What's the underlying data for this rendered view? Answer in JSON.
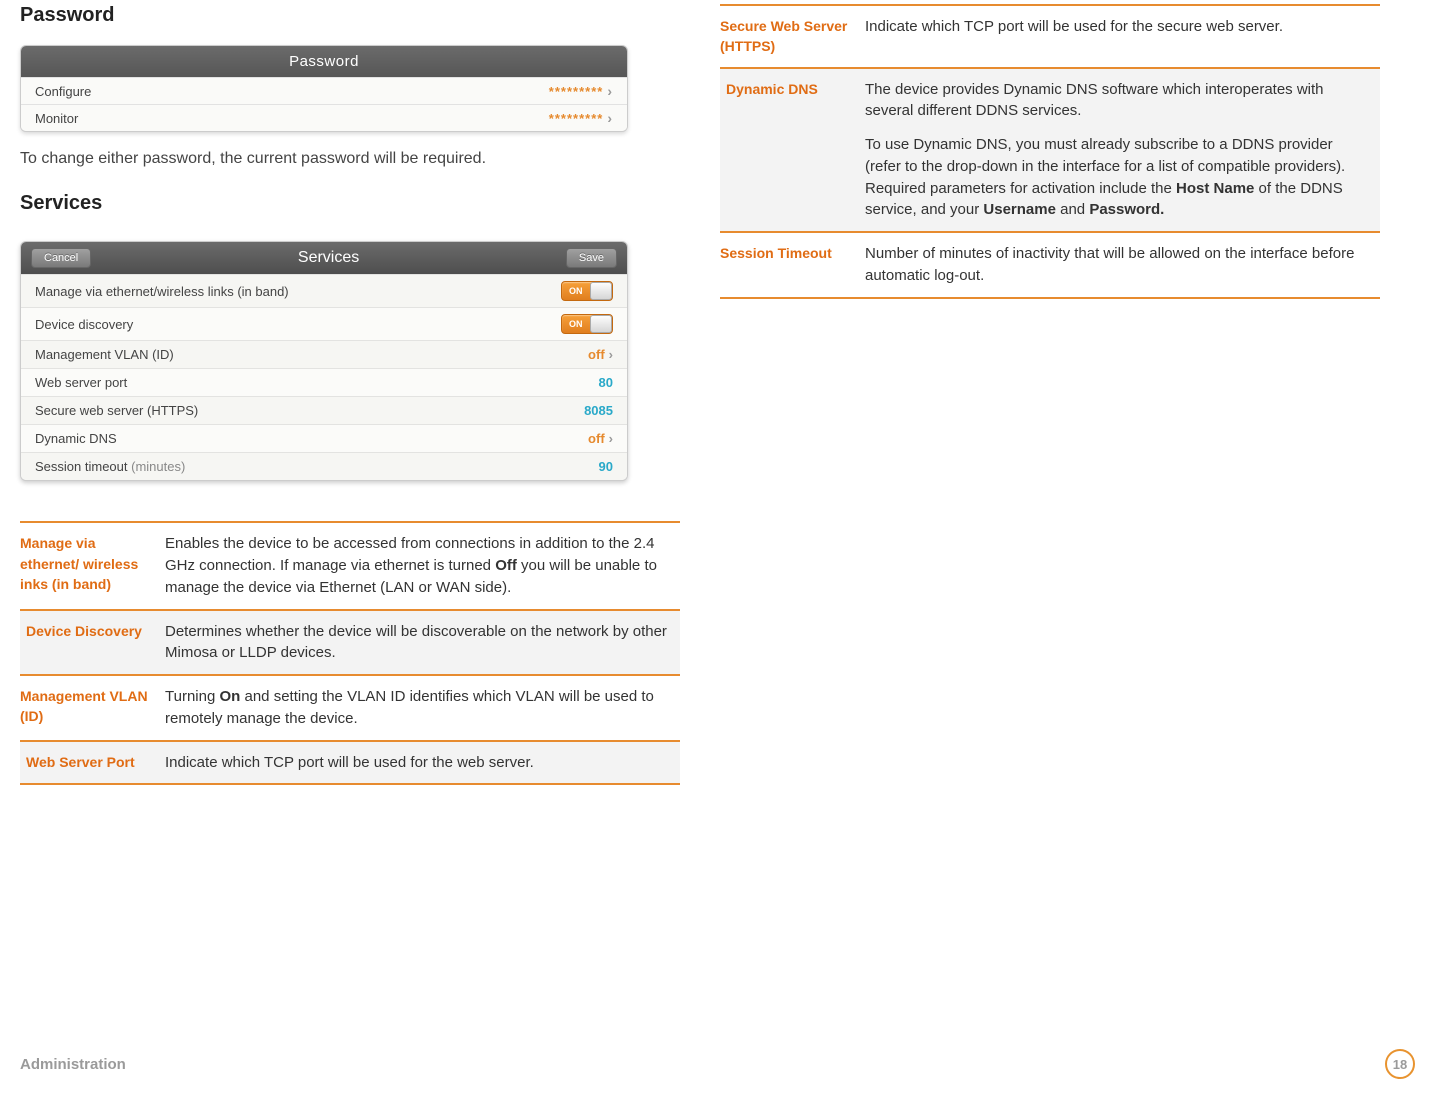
{
  "left": {
    "password": {
      "heading": "Password",
      "panel_title": "Password",
      "rows": [
        {
          "label": "Configure",
          "value": "*********"
        },
        {
          "label": "Monitor",
          "value": "*********"
        }
      ],
      "note": "To change either password, the current password will be required."
    },
    "services": {
      "heading": "Services",
      "panel_title": "Services",
      "cancel": "Cancel",
      "save": "Save",
      "rows": {
        "manage": {
          "label": "Manage via ethernet/wireless links (in band)",
          "toggle_text": "ON"
        },
        "discover": {
          "label": "Device discovery",
          "toggle_text": "ON"
        },
        "vlan": {
          "label": "Management VLAN (ID)",
          "value": "off"
        },
        "webport": {
          "label": "Web server port",
          "value": "80"
        },
        "https": {
          "label": "Secure web server (HTTPS)",
          "value": "8085"
        },
        "ddns": {
          "label": "Dynamic DNS",
          "value": "off"
        },
        "timeout": {
          "label_main": "Session timeout ",
          "label_muted": "(minutes)",
          "value": "90"
        }
      }
    },
    "defs": {
      "manage": {
        "term": "Manage via ethernet/ wireless inks (in band)",
        "desc_pre": "Enables the device to be accessed from connections in addition to the 2.4 GHz connection. If manage via ethernet is turned ",
        "desc_bold": "Off",
        "desc_post": " you will be unable to manage the device via Ethernet (LAN or WAN side)."
      },
      "discovery": {
        "term": "Device Discovery",
        "desc": "Determines whether the device will be discoverable on the network by other Mimosa or LLDP devices."
      },
      "vlan": {
        "term": "Management VLAN (ID)",
        "desc_pre": "Turning ",
        "desc_bold": "On",
        "desc_post": " and setting the VLAN ID identifies which VLAN will be used to remotely manage the device."
      },
      "webport": {
        "term": "Web Server Port",
        "desc": "Indicate which TCP port will be used for the web server."
      }
    }
  },
  "right": {
    "https": {
      "term": "Secure Web Server (HTTPS)",
      "desc": "Indicate which TCP port will be used for the secure web server."
    },
    "ddns": {
      "term": "Dynamic DNS",
      "p1": "The device provides Dynamic DNS software which interoperates with several different DDNS services.",
      "p2_pre": "To use Dynamic DNS, you must already subscribe to a DDNS provider (refer to the drop-down in the interface for a list of compatible providers). Required parameters for activation include the ",
      "p2_b1": "Host Name",
      "p2_mid": " of the DDNS service, and your ",
      "p2_b2": "Username",
      "p2_and": " and ",
      "p2_b3": "Password."
    },
    "timeout": {
      "term": "Session Timeout",
      "desc": "Number of minutes of inactivity that will be allowed on the interface before automatic log-out."
    }
  },
  "footer": {
    "section": "Administration",
    "page": "18"
  }
}
